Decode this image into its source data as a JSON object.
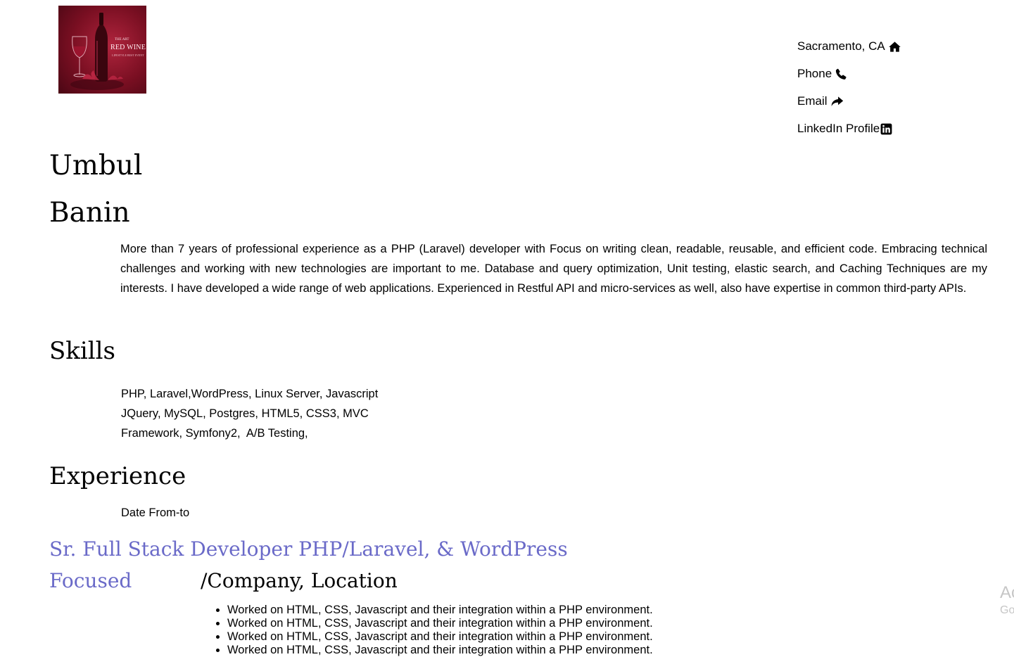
{
  "logo": {
    "subtitle": "THE ART",
    "title": "RED WINE",
    "tagline": "LIFESTYLE BEST EVENT"
  },
  "contact": {
    "location": {
      "label": "Sacramento, CA",
      "icon": "home-icon"
    },
    "phone": {
      "label": "Phone",
      "icon": "phone-icon"
    },
    "email": {
      "label": "Email",
      "icon": "share-arrow-icon"
    },
    "linkedin": {
      "label": "LinkedIn Profile",
      "icon": "linkedin-icon"
    }
  },
  "name": {
    "first": "Umbul",
    "last": "Banin"
  },
  "summary": "More than 7 years of professional experience as a PHP (Laravel) developer with Focus on writing clean, readable, reusable, and efficient code. Embracing technical challenges and working with new technologies are important to me. Database and query optimization, Unit testing, elastic search, and Caching Techniques are my interests. I have developed a wide range of web applications. Experienced in Restful API and micro-services as well, also have expertise in common third-party APIs.",
  "skills": {
    "heading": "Skills",
    "lines": [
      "PHP, Laravel,WordPress, Linux Server, Javascript",
      "JQuery, MySQL, Postgres, HTML5, CSS3, MVC",
      "Framework, Symfony2,  A/B Testing,"
    ]
  },
  "experience": {
    "heading": "Experience",
    "date": "Date From-to",
    "job_title_line1": "Sr. Full Stack Developer PHP/Laravel, & WordPress",
    "job_title_line2": "Focused",
    "company": "/Company, Location",
    "duties": [
      "Worked on HTML, CSS, Javascript and their integration within a PHP environment.",
      "Worked on HTML, CSS, Javascript and their integration within a PHP environment.",
      "Worked on HTML, CSS, Javascript and their integration within a PHP environment.",
      "Worked on HTML, CSS, Javascript and their integration within a PHP environment."
    ]
  },
  "watermark": {
    "line1": "Ac",
    "line2": "Go"
  },
  "colors": {
    "accent": "#6a6ac8",
    "logo_bg": "#7a0f22"
  }
}
